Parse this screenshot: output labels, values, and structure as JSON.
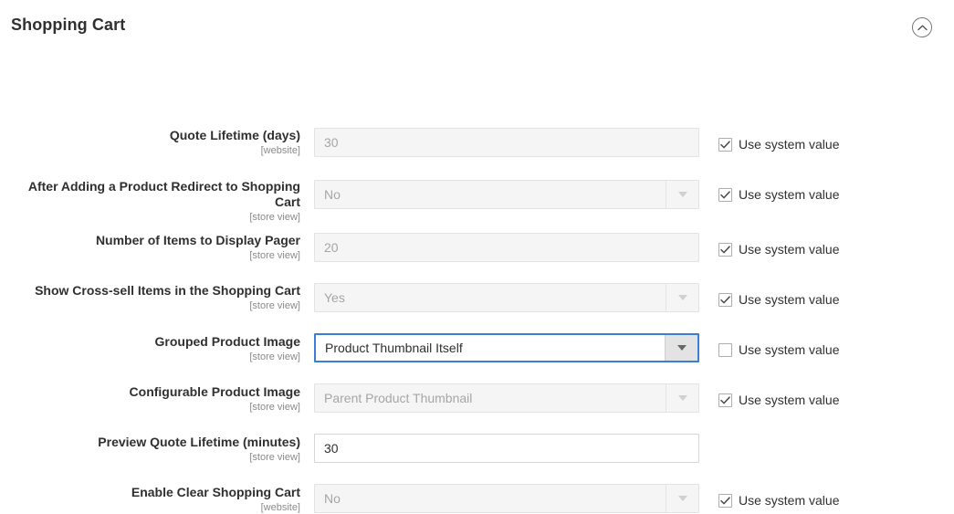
{
  "section": {
    "title": "Shopping Cart",
    "collapse_icon": "chevron-up-circle-icon"
  },
  "use_system_value_label": "Use system value",
  "colors": {
    "focus_border": "#3b7fd4",
    "disabled_bg": "#f5f5f5",
    "disabled_text": "#a6a6a6",
    "text": "#303030",
    "scope_text": "#8a8a8a"
  },
  "fields": [
    {
      "label": "Quote Lifetime (days)",
      "scope": "[website]",
      "type": "text",
      "value": "30",
      "disabled": true,
      "use_system_value": true
    },
    {
      "label": "After Adding a Product Redirect to Shopping Cart",
      "scope": "[store view]",
      "type": "select",
      "value": "No",
      "disabled": true,
      "use_system_value": true
    },
    {
      "label": "Number of Items to Display Pager",
      "scope": "[store view]",
      "type": "text",
      "value": "20",
      "disabled": true,
      "use_system_value": true
    },
    {
      "label": "Show Cross-sell Items in the Shopping Cart",
      "scope": "[store view]",
      "type": "select",
      "value": "Yes",
      "disabled": true,
      "use_system_value": true
    },
    {
      "label": "Grouped Product Image",
      "scope": "[store view]",
      "type": "select",
      "value": "Product Thumbnail Itself",
      "disabled": false,
      "active": true,
      "use_system_value": false
    },
    {
      "label": "Configurable Product Image",
      "scope": "[store view]",
      "type": "select",
      "value": "Parent Product Thumbnail",
      "disabled": true,
      "use_system_value": true
    },
    {
      "label": "Preview Quote Lifetime (minutes)",
      "scope": "[store view]",
      "type": "text",
      "value": "30",
      "disabled": false,
      "has_use_system_value": false
    },
    {
      "label": "Enable Clear Shopping Cart",
      "scope": "[website]",
      "type": "select",
      "value": "No",
      "disabled": true,
      "use_system_value": true
    }
  ]
}
